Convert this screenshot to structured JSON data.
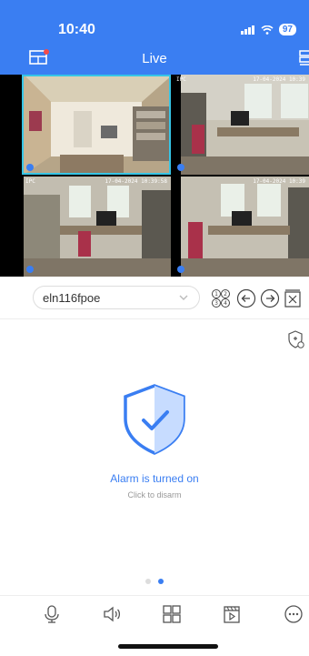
{
  "status_bar": {
    "time": "10:40",
    "battery": "97"
  },
  "header": {
    "title": "Live"
  },
  "cameras": [
    {
      "timestamp": "",
      "id": ""
    },
    {
      "timestamp": "17-04-2024 10:39",
      "id": "IPC"
    },
    {
      "timestamp": "17-04-2024 10:39:58",
      "id": "IPC"
    },
    {
      "timestamp": "17-04-2024 10:39",
      "id": ""
    }
  ],
  "device": {
    "name": "eln116fpoe"
  },
  "alarm": {
    "status": "Alarm is turned on",
    "hint": "Click to disarm"
  },
  "colors": {
    "accent": "#3a7ef2",
    "selected_border": "#36c5e6"
  },
  "pager": {
    "total": 2,
    "active": 2
  }
}
